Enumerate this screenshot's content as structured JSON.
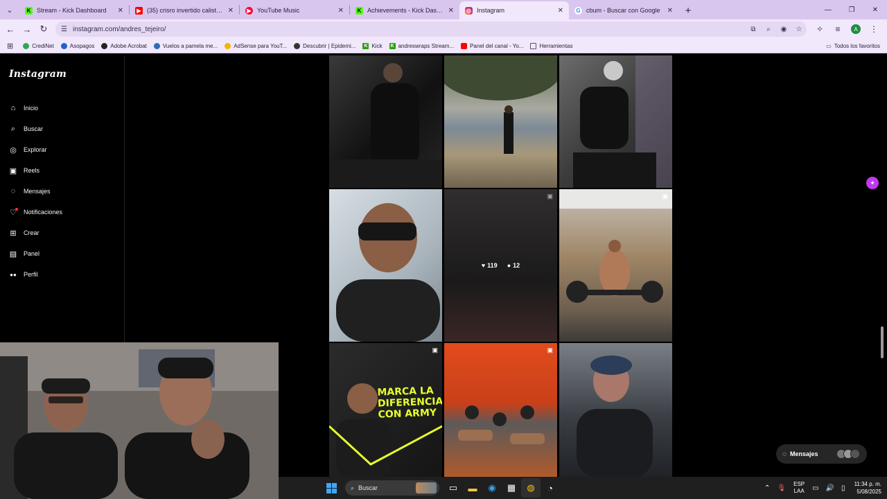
{
  "browser": {
    "tabs": [
      {
        "title": "Stream - Kick Dashboard",
        "icon": "kick-icon",
        "color": "#53fc18"
      },
      {
        "title": "(35) crisro invertido calistenes",
        "icon": "youtube-icon",
        "color": "#ff0000"
      },
      {
        "title": "YouTube Music",
        "icon": "youtube-music-icon",
        "color": "#ff0033"
      },
      {
        "title": "Achievements - Kick Dashboard",
        "icon": "kick-icon",
        "color": "#53fc18"
      },
      {
        "title": "Instagram",
        "icon": "instagram-icon",
        "color": "#e1306c"
      },
      {
        "title": "cbum - Buscar con Google",
        "icon": "google-icon",
        "color": "#4285f4"
      }
    ],
    "active_tab": "Instagram",
    "url": "instagram.com/andres_tejeiro/",
    "bookmarks": [
      {
        "label": "CrediNet",
        "color": "#2fa84f"
      },
      {
        "label": "Asopagos",
        "color": "#1e63c8"
      },
      {
        "label": "Adobe Acrobat",
        "color": "#222222"
      },
      {
        "label": "Vuelos a pamela me...",
        "color": "#2a6fb8"
      },
      {
        "label": "AdSense para YouT...",
        "color": "#f4b400"
      },
      {
        "label": "Descubrir | Epidemi...",
        "color": "#333333"
      },
      {
        "label": "Kick",
        "color": "#2c9f12"
      },
      {
        "label": "andreswraps Stream...",
        "color": "#2c9f12"
      },
      {
        "label": "Panel del canal - Yo...",
        "color": "#ff0000"
      },
      {
        "label": "Herramientas",
        "color": "#5b5170"
      }
    ],
    "bookmarks_right": "Todos los favoritos",
    "profile_initial": "A"
  },
  "instagram": {
    "logo": "Instagram",
    "nav": [
      {
        "label": "Inicio",
        "icon": "home-icon"
      },
      {
        "label": "Buscar",
        "icon": "search-icon"
      },
      {
        "label": "Explorar",
        "icon": "compass-icon"
      },
      {
        "label": "Reels",
        "icon": "reels-icon"
      },
      {
        "label": "Mensajes",
        "icon": "messenger-icon"
      },
      {
        "label": "Notificaciones",
        "icon": "heart-icon"
      },
      {
        "label": "Crear",
        "icon": "plus-square-icon"
      },
      {
        "label": "Panel",
        "icon": "dashboard-icon"
      },
      {
        "label": "Perfil",
        "icon": "profile-avatar"
      }
    ],
    "hovered_post": {
      "likes": "119",
      "comments": "12"
    },
    "promo_text": [
      "MARCA LA",
      "DIFERENCIA",
      "CON ARMY"
    ],
    "messages_button": "Mensajes"
  },
  "taskbar": {
    "search_label": "Buscar",
    "lang_top": "ESP",
    "lang_bottom": "LAA",
    "time": "11:34 p. m.",
    "date": "5/08/2025"
  }
}
